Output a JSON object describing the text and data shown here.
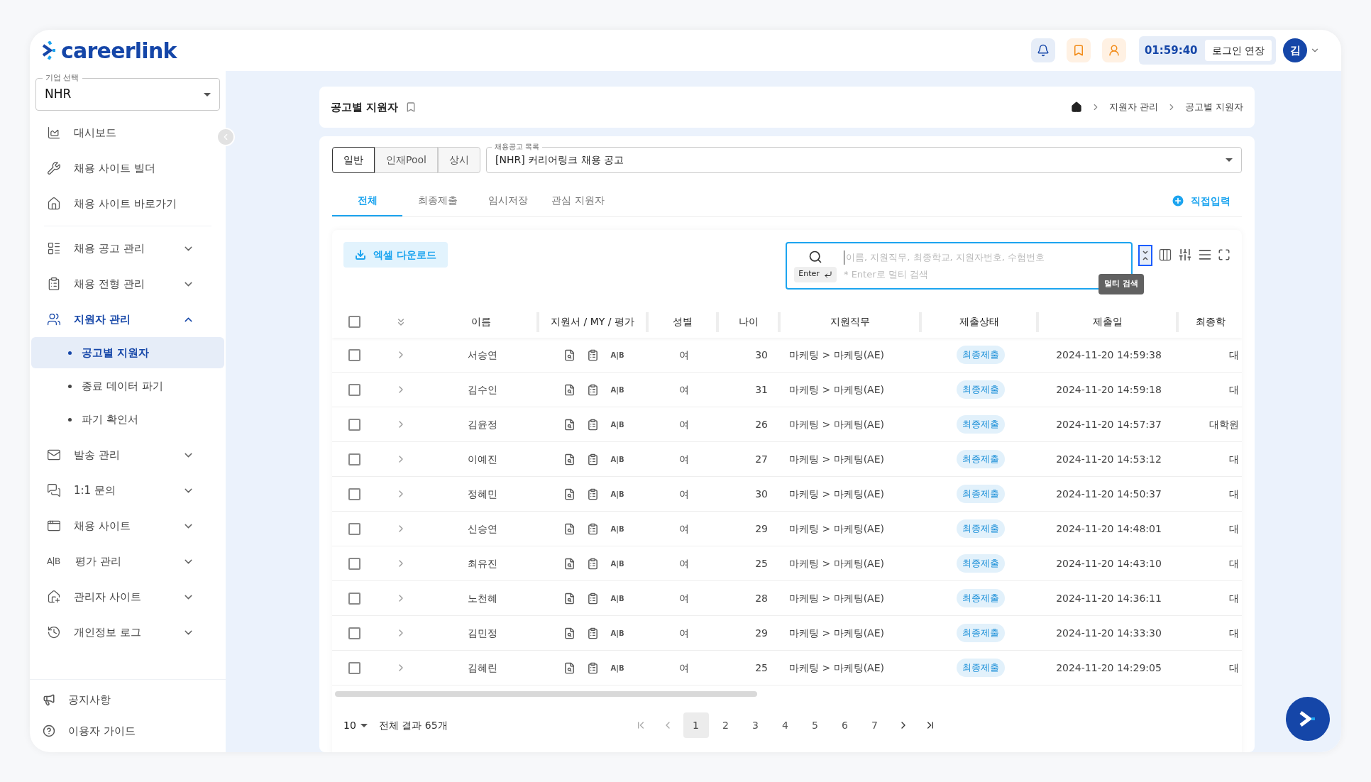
{
  "header": {
    "logo": "careerlink",
    "timer": "01:59:40",
    "extend_button": "로그인 연장",
    "avatar": "김"
  },
  "sidebar": {
    "company_select": {
      "label": "기업 선택",
      "value": "NHR"
    },
    "items": [
      {
        "label": "대시보드",
        "kind": "link",
        "selected": false
      },
      {
        "label": "채용 사이트 빌더",
        "kind": "link",
        "selected": false
      },
      {
        "label": "채용 사이트 바로가기",
        "kind": "link",
        "selected": false
      },
      {
        "kind": "divider"
      },
      {
        "label": "채용 공고 관리",
        "kind": "group",
        "selected": false,
        "expanded": false
      },
      {
        "label": "채용 전형 관리",
        "kind": "group",
        "selected": false,
        "expanded": false
      },
      {
        "label": "지원자 관리",
        "kind": "group",
        "selected": false,
        "expanded": true,
        "children": [
          {
            "label": "공고별 지원자",
            "selected": true
          },
          {
            "label": "종료 데이터 파기",
            "selected": false
          },
          {
            "label": "파기 확인서",
            "selected": false
          }
        ]
      },
      {
        "label": "발송 관리",
        "kind": "group",
        "selected": false,
        "expanded": false
      },
      {
        "label": "1:1 문의",
        "kind": "group",
        "selected": false,
        "expanded": false
      },
      {
        "label": "채용 사이트",
        "kind": "group",
        "selected": false,
        "expanded": false
      },
      {
        "label": "평가 관리",
        "kind": "group",
        "selected": false,
        "expanded": false,
        "icon_text": "A|B"
      },
      {
        "label": "관리자 사이트",
        "kind": "group",
        "selected": false,
        "expanded": false
      },
      {
        "label": "개인정보 로그",
        "kind": "group",
        "selected": false,
        "expanded": false
      }
    ],
    "footer": [
      {
        "label": "공지사항"
      },
      {
        "label": "이용자 가이드"
      }
    ]
  },
  "page": {
    "title": "공고별 지원자",
    "breadcrumb": [
      "지원자 관리",
      "공고별 지원자"
    ]
  },
  "segments": [
    {
      "label": "일반",
      "selected": true
    },
    {
      "label": "인재Pool",
      "selected": false
    },
    {
      "label": "상시",
      "selected": false
    }
  ],
  "posting_select": {
    "label": "채용공고 목록",
    "value": "[NHR] 커리어링크 채용 공고"
  },
  "tabs": [
    {
      "label": "전체",
      "selected": true
    },
    {
      "label": "최종제출",
      "selected": false
    },
    {
      "label": "임시저장",
      "selected": false
    },
    {
      "label": "관심 지원자",
      "selected": false
    }
  ],
  "direct_input": "직접입력",
  "excel_button": "엑셀 다운로드",
  "search": {
    "enter_key": "Enter",
    "placeholder": "이름, 지원직무, 최종학교, 지원자번호, 수험번호",
    "hint": "* Enter로 멀티 검색"
  },
  "multi_search_tooltip": "멀티 검색",
  "table": {
    "select_all_checked": false,
    "columns": [
      "이름",
      "지원서 / MY / 평가",
      "성별",
      "나이",
      "지원직무",
      "제출상태",
      "제출일",
      "최종학"
    ],
    "rows": [
      {
        "checked": false,
        "expanded": false,
        "name": "서승연",
        "eval": "A|B",
        "gender": "여",
        "age": "30",
        "job": "마케팅 > 마케팅(AE)",
        "status": "최종제출",
        "date": "2024-11-20 14:59:38",
        "edu": "대"
      },
      {
        "checked": false,
        "expanded": false,
        "name": "김수인",
        "eval": "A|B",
        "gender": "여",
        "age": "31",
        "job": "마케팅 > 마케팅(AE)",
        "status": "최종제출",
        "date": "2024-11-20 14:59:18",
        "edu": "대"
      },
      {
        "checked": false,
        "expanded": false,
        "name": "김윤정",
        "eval": "A|B",
        "gender": "여",
        "age": "26",
        "job": "마케팅 > 마케팅(AE)",
        "status": "최종제출",
        "date": "2024-11-20 14:57:37",
        "edu": "대학원"
      },
      {
        "checked": false,
        "expanded": false,
        "name": "이예진",
        "eval": "A|B",
        "gender": "여",
        "age": "27",
        "job": "마케팅 > 마케팅(AE)",
        "status": "최종제출",
        "date": "2024-11-20 14:53:12",
        "edu": "대"
      },
      {
        "checked": false,
        "expanded": false,
        "name": "정혜민",
        "eval": "A|B",
        "gender": "여",
        "age": "30",
        "job": "마케팅 > 마케팅(AE)",
        "status": "최종제출",
        "date": "2024-11-20 14:50:37",
        "edu": "대"
      },
      {
        "checked": false,
        "expanded": false,
        "name": "신승연",
        "eval": "A|B",
        "gender": "여",
        "age": "29",
        "job": "마케팅 > 마케팅(AE)",
        "status": "최종제출",
        "date": "2024-11-20 14:48:01",
        "edu": "대"
      },
      {
        "checked": false,
        "expanded": false,
        "name": "최유진",
        "eval": "A|B",
        "gender": "여",
        "age": "25",
        "job": "마케팅 > 마케팅(AE)",
        "status": "최종제출",
        "date": "2024-11-20 14:43:10",
        "edu": "대"
      },
      {
        "checked": false,
        "expanded": false,
        "name": "노천혜",
        "eval": "A|B",
        "gender": "여",
        "age": "28",
        "job": "마케팅 > 마케팅(AE)",
        "status": "최종제출",
        "date": "2024-11-20 14:36:11",
        "edu": "대"
      },
      {
        "checked": false,
        "expanded": false,
        "name": "김민정",
        "eval": "A|B",
        "gender": "여",
        "age": "29",
        "job": "마케팅 > 마케팅(AE)",
        "status": "최종제출",
        "date": "2024-11-20 14:33:30",
        "edu": "대"
      },
      {
        "checked": false,
        "expanded": false,
        "name": "김혜린",
        "eval": "A|B",
        "gender": "여",
        "age": "25",
        "job": "마케팅 > 마케팅(AE)",
        "status": "최종제출",
        "date": "2024-11-20 14:29:05",
        "edu": "대"
      }
    ]
  },
  "pagination": {
    "page_size": "10",
    "total": "전체 결과 65개",
    "pages": [
      {
        "label": "1",
        "selected": true
      },
      {
        "label": "2",
        "selected": false
      },
      {
        "label": "3",
        "selected": false
      },
      {
        "label": "4",
        "selected": false
      },
      {
        "label": "5",
        "selected": false
      },
      {
        "label": "6",
        "selected": false
      },
      {
        "label": "7",
        "selected": false
      }
    ]
  }
}
